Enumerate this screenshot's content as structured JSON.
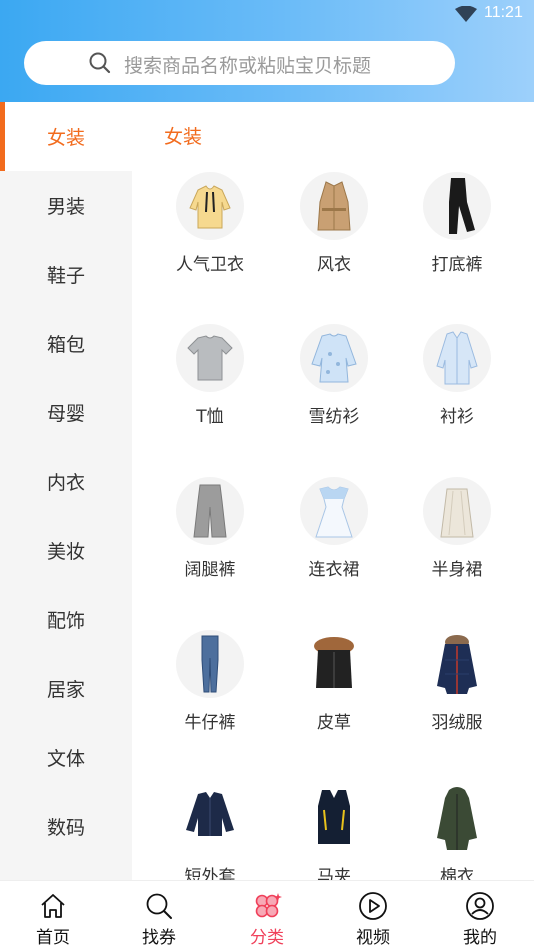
{
  "status_bar": {
    "time": "11:21",
    "wifi_icon": "wifi-icon"
  },
  "search": {
    "placeholder": "搜索商品名称或粘贴宝贝标题",
    "icon": "search-icon"
  },
  "colors": {
    "accent": "#f26b1d",
    "header_start": "#3ba8f2",
    "header_end": "#9dd0fb",
    "nav_active": "#f0405a",
    "sidebar_bg": "#f5f5f5"
  },
  "sidebar": {
    "items": [
      {
        "label": "女装",
        "active": true
      },
      {
        "label": "男装"
      },
      {
        "label": "鞋子"
      },
      {
        "label": "箱包"
      },
      {
        "label": "母婴"
      },
      {
        "label": "内衣"
      },
      {
        "label": "美妆"
      },
      {
        "label": "配饰"
      },
      {
        "label": "居家"
      },
      {
        "label": "文体"
      },
      {
        "label": "数码"
      }
    ]
  },
  "content": {
    "title": "女装",
    "items": [
      {
        "label": "人气卫衣",
        "icon": "hoodie-icon"
      },
      {
        "label": "风衣",
        "icon": "trench-coat-icon"
      },
      {
        "label": "打底裤",
        "icon": "leggings-icon"
      },
      {
        "label": "T恤",
        "icon": "tshirt-icon"
      },
      {
        "label": "雪纺衫",
        "icon": "chiffon-blouse-icon"
      },
      {
        "label": "衬衫",
        "icon": "shirt-icon"
      },
      {
        "label": "阔腿裤",
        "icon": "wide-leg-pants-icon"
      },
      {
        "label": "连衣裙",
        "icon": "dress-icon"
      },
      {
        "label": "半身裙",
        "icon": "skirt-icon"
      },
      {
        "label": "牛仔裤",
        "icon": "jeans-icon"
      },
      {
        "label": "皮草",
        "icon": "fur-vest-icon"
      },
      {
        "label": "羽绒服",
        "icon": "down-jacket-icon"
      },
      {
        "label": "短外套",
        "icon": "short-jacket-icon"
      },
      {
        "label": "马夹",
        "icon": "vest-icon"
      },
      {
        "label": "棉衣",
        "icon": "padded-coat-icon"
      }
    ]
  },
  "bottom_nav": {
    "items": [
      {
        "label": "首页",
        "icon": "home-icon"
      },
      {
        "label": "找券",
        "icon": "search-icon"
      },
      {
        "label": "分类",
        "icon": "category-icon",
        "active": true
      },
      {
        "label": "视频",
        "icon": "play-icon"
      },
      {
        "label": "我的",
        "icon": "user-icon"
      }
    ]
  }
}
